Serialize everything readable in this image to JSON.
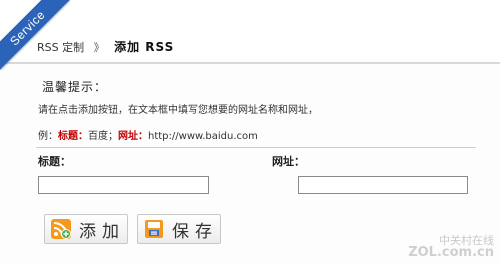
{
  "ribbon": {
    "label": "Service"
  },
  "breadcrumb": {
    "parent": "RSS 定制",
    "separator": "》",
    "current": "添加  RSS"
  },
  "tip": {
    "title": "温馨提示：",
    "text": "请在点击添加按钮，在文本框中填写您想要的网址名称和网址，",
    "example_prefix": "例：",
    "example_title_label": "标题：",
    "example_title_value": "百度；",
    "example_url_label": "网址：",
    "example_url_value": "http://www.baidu.com"
  },
  "form": {
    "title_label": "标题：",
    "title_value": "",
    "url_label": "网址：",
    "url_value": ""
  },
  "buttons": {
    "add_label": "添加",
    "save_label": "保存"
  },
  "watermark": {
    "line1": "中关村在线",
    "line2": "ZOL.com.cn"
  },
  "colors": {
    "ribbon": "#2a63b8",
    "highlight": "#c00000",
    "rss_icon": "#f39a1e"
  }
}
